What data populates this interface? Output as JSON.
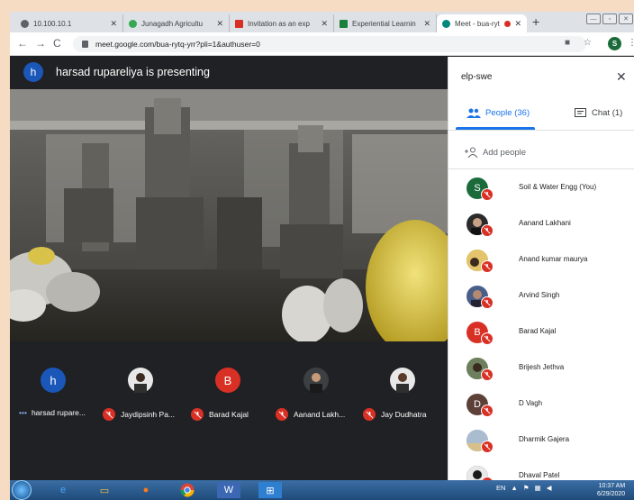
{
  "browser": {
    "tabs": [
      {
        "label": "10.100.10.1",
        "color": "#5f6368"
      },
      {
        "label": "Junagadh Agricultu",
        "color": "#34a853"
      },
      {
        "label": "Invitation as an exp",
        "color": "#d93025"
      },
      {
        "label": "Experiential Learnin",
        "color": "#188038"
      },
      {
        "label": "Meet - bua-ryt",
        "color": "#00897b",
        "active": true
      }
    ],
    "new_tab": "+",
    "url": "meet.google.com/bua-rytq-yrr?pli=1&authuser=0",
    "profile_initial": "S"
  },
  "meet": {
    "presenter_initial": "h",
    "presenter_text": "harsad rupareliya is presenting",
    "tiles": [
      {
        "name": "harsad rupare...",
        "initial": "h",
        "color": "#1a57b8",
        "muted": false
      },
      {
        "name": "Jaydipsinh Pa...",
        "initial": "",
        "color": "#e8e8e8",
        "muted": true
      },
      {
        "name": "Barad Kajal",
        "initial": "B",
        "color": "#d93025",
        "muted": true
      },
      {
        "name": "Aanand Lakh...",
        "initial": "",
        "color": "#3c4043",
        "muted": true
      },
      {
        "name": "Jay Dudhatra",
        "initial": "",
        "color": "#e8e8e8",
        "muted": true
      }
    ]
  },
  "panel": {
    "title": "elp-swe",
    "close": "✕",
    "people_tab": "People (36)",
    "chat_tab": "Chat (1)",
    "add_people": "Add people",
    "people": [
      {
        "name": "Soil & Water Engg (You)",
        "initial": "S",
        "color": "#1b6b3a"
      },
      {
        "name": "Aanand Lakhani",
        "initial": "",
        "color": "#2b2b2b"
      },
      {
        "name": "Anand kumar maurya",
        "initial": "",
        "color": "#c9a44a"
      },
      {
        "name": "Arvind Singh",
        "initial": "",
        "color": "#4a5e8a"
      },
      {
        "name": "Barad Kajal",
        "initial": "B",
        "color": "#d93025"
      },
      {
        "name": "Brijesh Jethva",
        "initial": "",
        "color": "#556b4a"
      },
      {
        "name": "D Vagh",
        "initial": "D",
        "color": "#5d4037"
      },
      {
        "name": "Dharmik Gajera",
        "initial": "",
        "color": "#8fa4b8"
      },
      {
        "name": "Dhaval Patel",
        "initial": "",
        "color": "#2f2f2f"
      }
    ]
  },
  "taskbar": {
    "lang": "EN",
    "time": "10:37 AM",
    "date": "6/29/2020"
  }
}
